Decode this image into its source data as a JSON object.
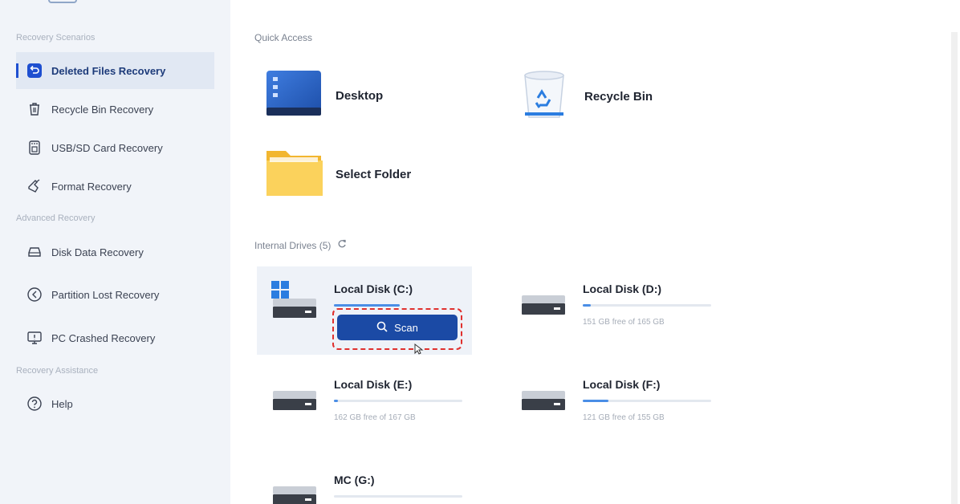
{
  "sidebar": {
    "section_scenarios": "Recovery Scenarios",
    "section_advanced": "Advanced Recovery",
    "section_assistance": "Recovery Assistance",
    "items": [
      {
        "label": "Deleted Files Recovery",
        "icon": "restore-icon"
      },
      {
        "label": "Recycle Bin Recovery",
        "icon": "trash-icon"
      },
      {
        "label": "USB/SD Card Recovery",
        "icon": "usb-sd-icon"
      },
      {
        "label": "Format Recovery",
        "icon": "format-icon"
      },
      {
        "label": "Disk Data Recovery",
        "icon": "disk-icon"
      },
      {
        "label": "Partition Lost Recovery",
        "icon": "partition-icon"
      },
      {
        "label": "PC Crashed Recovery",
        "icon": "pc-crash-icon"
      },
      {
        "label": "Help",
        "icon": "help-icon"
      }
    ]
  },
  "quick_access": {
    "label": "Quick Access",
    "items": [
      {
        "label": "Desktop",
        "icon": "desktop-icon"
      },
      {
        "label": "Recycle Bin",
        "icon": "recycle-bin-icon"
      },
      {
        "label": "Select Folder",
        "icon": "folder-icon"
      }
    ]
  },
  "internal_drives": {
    "label": "Internal Drives (5)",
    "drives": [
      {
        "name": "Local Disk (C:)",
        "info": "",
        "usage": 0.5
      },
      {
        "name": "Local Disk (D:)",
        "info": "151 GB free of 165 GB",
        "usage": 0.06
      },
      {
        "name": "Local Disk (E:)",
        "info": "162 GB free of 167 GB",
        "usage": 0.03
      },
      {
        "name": "Local Disk (F:)",
        "info": "121 GB free of 155 GB",
        "usage": 0.2
      },
      {
        "name": "MC (G:)",
        "info": "",
        "usage": 0.0
      }
    ]
  },
  "scan_button": {
    "label": "Scan"
  },
  "colors": {
    "accent": "#1b4aa5",
    "highlight_dash": "#e0312e",
    "sidebar_bg": "#f1f4f9"
  }
}
